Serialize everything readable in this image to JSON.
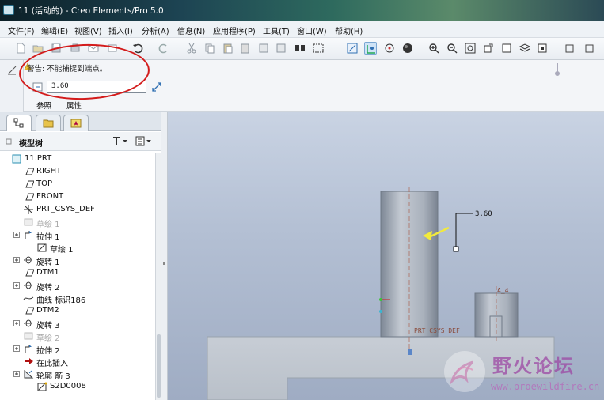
{
  "window": {
    "title": "11 (活动的) - Creo Elements/Pro 5.0"
  },
  "menubar": [
    {
      "label": "文件(F)"
    },
    {
      "label": "编辑(E)"
    },
    {
      "label": "视图(V)"
    },
    {
      "label": "插入(I)"
    },
    {
      "label": "分析(A)"
    },
    {
      "label": "信息(N)"
    },
    {
      "label": "应用程序(P)"
    },
    {
      "label": "工具(T)"
    },
    {
      "label": "窗口(W)"
    },
    {
      "label": "帮助(H)"
    }
  ],
  "toolbar": {
    "icons": [
      "new-file-icon",
      "open-icon",
      "save-icon",
      "print-icon",
      "email-icon",
      "undo-icon",
      "redo-icon",
      "cut-icon",
      "copy-icon",
      "paste-icon",
      "regenerate-icon",
      "find-icon",
      "select-box-icon",
      "repaint-icon",
      "orient-icon",
      "spin-center-icon",
      "shading-icon",
      "zoom-in-icon",
      "zoom-out-icon",
      "refit-icon",
      "reorient-icon",
      "view-manager-icon",
      "layers-icon",
      "datum-plane-icon",
      "datum-axis-icon"
    ]
  },
  "dashboard": {
    "warning": "警告: 不能捕捉到端点。",
    "value": "3.60",
    "tabs": [
      {
        "label": "参照"
      },
      {
        "label": "属性"
      }
    ]
  },
  "tree": {
    "title": "模型树",
    "items": [
      {
        "label": "11.PRT",
        "icon": "part-icon",
        "expander": false,
        "dim": false
      },
      {
        "label": "RIGHT",
        "icon": "datum-plane-icon",
        "expander": false,
        "dim": false
      },
      {
        "label": "TOP",
        "icon": "datum-plane-icon",
        "expander": false,
        "dim": false
      },
      {
        "label": "FRONT",
        "icon": "datum-plane-icon",
        "expander": false,
        "dim": false
      },
      {
        "label": "PRT_CSYS_DEF",
        "icon": "csys-icon",
        "expander": false,
        "dim": false
      },
      {
        "label": "草绘 1",
        "icon": "sketch-icon",
        "expander": false,
        "dim": true
      },
      {
        "label": "拉伸 1",
        "icon": "extrude-icon",
        "expander": true,
        "dim": false
      },
      {
        "label": "草绘 1",
        "icon": "sketch-icon",
        "expander": false,
        "dim": false,
        "indent": true
      },
      {
        "label": "旋转 1",
        "icon": "revolve-icon",
        "expander": true,
        "dim": false
      },
      {
        "label": "DTM1",
        "icon": "datum-plane-icon",
        "expander": false,
        "dim": false
      },
      {
        "label": "旋转 2",
        "icon": "revolve-icon",
        "expander": true,
        "dim": false
      },
      {
        "label": "曲线 标识186",
        "icon": "curve-icon",
        "expander": false,
        "dim": false
      },
      {
        "label": "DTM2",
        "icon": "datum-plane-icon",
        "expander": false,
        "dim": false
      },
      {
        "label": "旋转 3",
        "icon": "revolve-icon",
        "expander": true,
        "dim": false
      },
      {
        "label": "草绘 2",
        "icon": "sketch-icon",
        "expander": false,
        "dim": true
      },
      {
        "label": "拉伸 2",
        "icon": "extrude-icon",
        "expander": true,
        "dim": false
      },
      {
        "label": "在此插入",
        "icon": "insert-arrow-icon",
        "expander": false,
        "dim": false
      },
      {
        "label": "轮廓 筋 3",
        "icon": "rib-icon",
        "expander": true,
        "dim": false
      },
      {
        "label": "S2D0008",
        "icon": "sketch-icon",
        "expander": false,
        "dim": false,
        "indent": true
      }
    ]
  },
  "graphics": {
    "dimension_value": "3.60",
    "labels": {
      "csys": "PRT_CSYS_DEF",
      "axis": "A_4"
    }
  },
  "watermark": {
    "text": "野火论坛",
    "url": "www.proewildfire.cn"
  },
  "colors": {
    "annotation": "#d31b1b",
    "accent": "#2a6f8a"
  }
}
